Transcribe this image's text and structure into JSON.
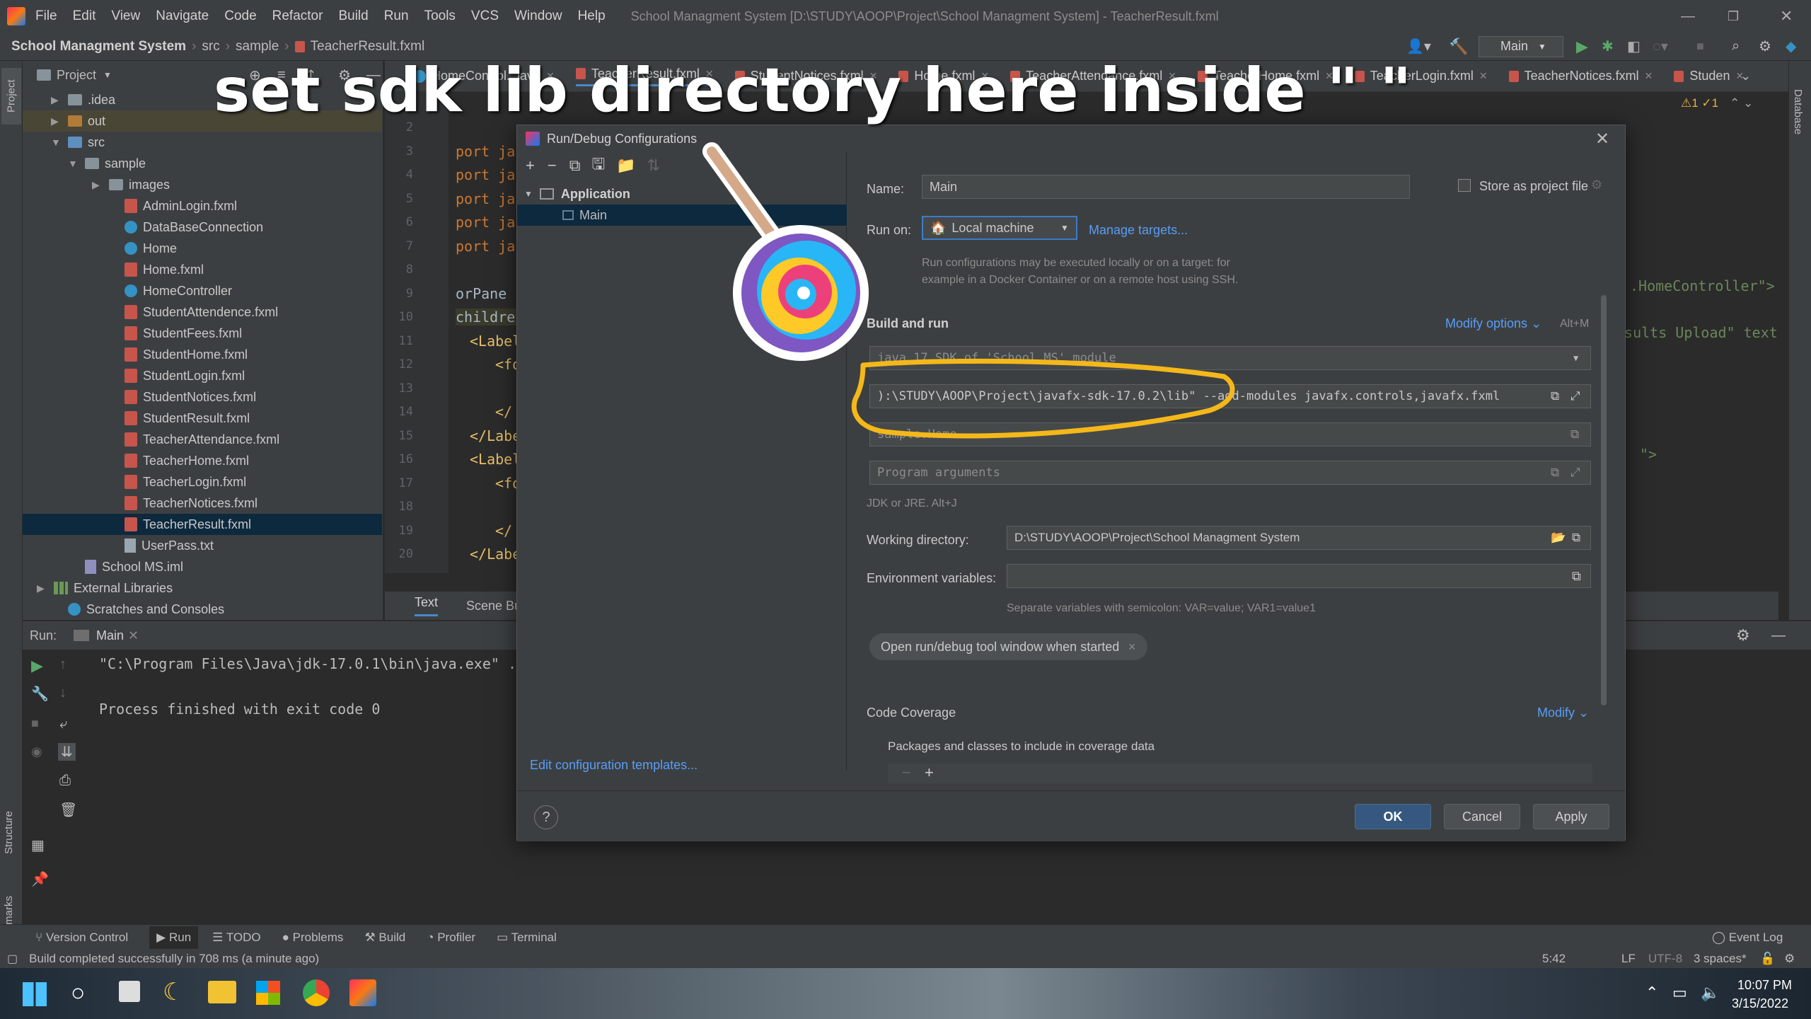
{
  "window": {
    "title": "School Managment System [D:\\STUDY\\AOOP\\Project\\School Managment System] - TeacherResult.fxml"
  },
  "menu": [
    "File",
    "Edit",
    "View",
    "Navigate",
    "Code",
    "Refactor",
    "Build",
    "Run",
    "Tools",
    "VCS",
    "Window",
    "Help"
  ],
  "breadcrumb": {
    "project": "School Managment System",
    "src": "src",
    "pkg": "sample",
    "file": "TeacherResult.fxml"
  },
  "toolbar": {
    "run_config": "Main"
  },
  "overlay": {
    "caption": "set sdk lib directory here inside \" \""
  },
  "project_panel": {
    "title": "Project",
    "items": [
      {
        "label": ".idea",
        "kind": "folder"
      },
      {
        "label": "out",
        "kind": "folder-orange"
      },
      {
        "label": "src",
        "kind": "folder-blue"
      },
      {
        "label": "sample",
        "kind": "package"
      },
      {
        "label": "images",
        "kind": "folder"
      },
      {
        "label": "AdminLogin.fxml",
        "kind": "fxml"
      },
      {
        "label": "DataBaseConnection",
        "kind": "class"
      },
      {
        "label": "Home",
        "kind": "class"
      },
      {
        "label": "Home.fxml",
        "kind": "fxml"
      },
      {
        "label": "HomeController",
        "kind": "class"
      },
      {
        "label": "StudentAttendence.fxml",
        "kind": "fxml"
      },
      {
        "label": "StudentFees.fxml",
        "kind": "fxml"
      },
      {
        "label": "StudentHome.fxml",
        "kind": "fxml"
      },
      {
        "label": "StudentLogin.fxml",
        "kind": "fxml"
      },
      {
        "label": "StudentNotices.fxml",
        "kind": "fxml"
      },
      {
        "label": "StudentResult.fxml",
        "kind": "fxml"
      },
      {
        "label": "TeacherAttendance.fxml",
        "kind": "fxml"
      },
      {
        "label": "TeacherHome.fxml",
        "kind": "fxml"
      },
      {
        "label": "TeacherLogin.fxml",
        "kind": "fxml"
      },
      {
        "label": "TeacherNotices.fxml",
        "kind": "fxml"
      },
      {
        "label": "TeacherResult.fxml",
        "kind": "fxml"
      },
      {
        "label": "UserPass.txt",
        "kind": "txt"
      },
      {
        "label": "School MS.iml",
        "kind": "iml"
      },
      {
        "label": "External Libraries",
        "kind": "lib"
      },
      {
        "label": "Scratches and Consoles",
        "kind": "scratch"
      }
    ]
  },
  "tabs": [
    "HomeControl...java",
    "TeacherResult.fxml",
    "StudentNotices.fxml",
    "Home.fxml",
    "TeacherAttendance.fxml",
    "TeacherHome.fxml",
    "TeacherLogin.fxml",
    "TeacherNotices.fxml",
    "Studen"
  ],
  "editor": {
    "line_numbers": [
      "2",
      "3",
      "4",
      "5",
      "6",
      "7",
      "8",
      "9",
      "10",
      "11",
      "12",
      "13",
      "14",
      "15",
      "16",
      "17",
      "18",
      "19",
      "20"
    ],
    "lines": [
      "",
      "port ja",
      "port ja",
      "port ja",
      "port ja",
      "port ja",
      "",
      "orPane",
      "children",
      "<Label",
      "<fo",
      "",
      "</",
      "</Labe",
      "<Label",
      "<fo",
      "",
      "</",
      "</Labe"
    ],
    "right_fragments": [
      ".HomeController\">",
      "esults Upload\" text",
      "\">"
    ],
    "inspections": "⚠1 ✓1",
    "bottom_tabs": [
      "Text",
      "Scene Bu"
    ]
  },
  "run_panel": {
    "label": "Run:",
    "tab": "Main",
    "cmd": "\"C:\\Program Files\\Java\\jdk-17.0.1\\bin\\java.exe\" ..",
    "output": "Process finished with exit code 0"
  },
  "dialog": {
    "title": "Run/Debug Configurations",
    "tree_group": "Application",
    "tree_item": "Main",
    "edit_templates": "Edit configuration templates...",
    "name_label": "Name:",
    "name_value": "Main",
    "store_label": "Store as project file",
    "run_on_label": "Run on:",
    "run_on_value": "Local machine",
    "manage_targets": "Manage targets...",
    "run_on_hint_1": "Run configurations may be executed locally or on a target: for",
    "run_on_hint_2": "example in a Docker Container or on a remote host using SSH.",
    "build_run": "Build and run",
    "modify_options": "Modify options",
    "modify_shortcut": "Alt+M",
    "sdk_value": "java 17  SDK of 'School MS' module",
    "vm_options": "):\\STUDY\\AOOP\\Project\\javafx-sdk-17.0.2\\lib\" --add-modules javafx.controls,javafx.fxml",
    "main_class": "sample.Home",
    "program_args_placeholder": "Program arguments",
    "jdk_hint": "JDK or JRE. Alt+J",
    "workdir_label": "Working directory:",
    "workdir_value": "D:\\STUDY\\AOOP\\Project\\School Managment System",
    "env_label": "Environment variables:",
    "env_hint": "Separate variables with semicolon: VAR=value; VAR1=value1",
    "open_tool_window": "Open run/debug tool window when started",
    "code_coverage": "Code Coverage",
    "modify": "Modify",
    "packages_label": "Packages and classes to include in coverage data",
    "ok": "OK",
    "cancel": "Cancel",
    "apply": "Apply",
    "help": "?"
  },
  "bottom_tools": [
    "Version Control",
    "Run",
    "TODO",
    "Problems",
    "Build",
    "Profiler",
    "Terminal"
  ],
  "event_log": "Event Log",
  "status": {
    "message": "Build completed successfully in 708 ms (a minute ago)",
    "pos": "5:42",
    "le": "LF",
    "enc": "UTF-8",
    "indent": "3 spaces*"
  },
  "side_labels": {
    "project": "Project",
    "structure": "Structure",
    "bookmarks": "Bookmarks",
    "database": "Database"
  },
  "clock": {
    "time": "10:07 PM",
    "date": "3/15/2022"
  },
  "colors": {
    "accent": "#365880",
    "link": "#589df6",
    "highlight": "#f5b81a"
  }
}
